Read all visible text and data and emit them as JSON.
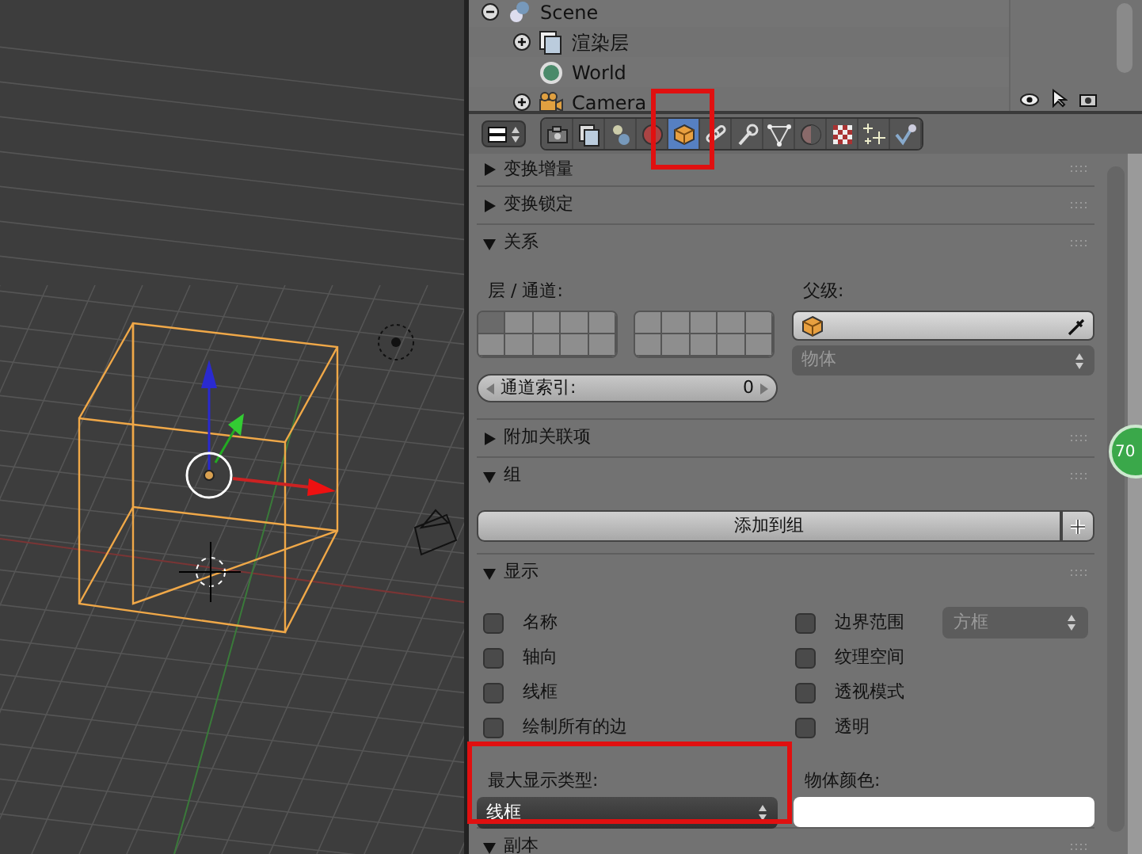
{
  "outliner": {
    "tree": [
      {
        "label": "Scene",
        "kind": "scene",
        "expanded": true,
        "children": [
          {
            "label": "渲染层",
            "kind": "render_layer",
            "expanded": false
          },
          {
            "label": "World",
            "kind": "world"
          },
          {
            "label": "Camera",
            "kind": "camera",
            "expanded": false
          }
        ]
      }
    ]
  },
  "properties_tabs": [
    {
      "kind": "render",
      "selected": false
    },
    {
      "kind": "render_layer",
      "selected": false
    },
    {
      "kind": "scene",
      "selected": false
    },
    {
      "kind": "world",
      "selected": false
    },
    {
      "kind": "object",
      "selected": true
    },
    {
      "kind": "constraint",
      "selected": false
    },
    {
      "kind": "modifier",
      "selected": false
    },
    {
      "kind": "data",
      "selected": false
    },
    {
      "kind": "material",
      "selected": false
    },
    {
      "kind": "texture",
      "selected": false
    },
    {
      "kind": "particles",
      "selected": false
    },
    {
      "kind": "physics",
      "selected": false
    }
  ],
  "panels": [
    {
      "title": "变换增量",
      "expanded": false
    },
    {
      "title": "变换锁定",
      "expanded": false
    },
    {
      "kind": "relations",
      "title": "关系",
      "expanded": true,
      "layers_label": "层 / 通道:",
      "parent_label": "父级:",
      "parent_type": "物体",
      "pass_index_label": "通道索引:",
      "pass_index": "0",
      "layers": [
        {
          "selected": true
        },
        {
          "selected": false
        },
        {
          "selected": false
        },
        {
          "selected": false
        },
        {
          "selected": false
        },
        {
          "selected": false
        },
        {
          "selected": false
        },
        {
          "selected": false
        },
        {
          "selected": false
        },
        {
          "selected": false
        },
        {
          "selected": false
        },
        {
          "selected": false
        },
        {
          "selected": false
        },
        {
          "selected": false
        },
        {
          "selected": false
        },
        {
          "selected": false
        },
        {
          "selected": false
        },
        {
          "selected": false
        },
        {
          "selected": false
        },
        {
          "selected": false
        }
      ]
    },
    {
      "title": "附加关联项",
      "expanded": false
    },
    {
      "kind": "groups",
      "title": "组",
      "expanded": true,
      "button": "添加到组"
    },
    {
      "kind": "display",
      "title": "显示",
      "expanded": true,
      "left_checks": [
        {
          "label": "名称",
          "checked": false
        },
        {
          "label": "轴向",
          "checked": false
        },
        {
          "label": "线框",
          "checked": false
        },
        {
          "label": "绘制所有的边",
          "checked": false
        }
      ],
      "right_checks": [
        {
          "label": "边界范围",
          "checked": false
        },
        {
          "label": "纹理空间",
          "checked": false
        },
        {
          "label": "透视模式",
          "checked": false
        },
        {
          "label": "透明",
          "checked": false
        }
      ],
      "bounds_type": {
        "value": "方框",
        "disabled": true
      },
      "max_draw_label": "最大显示类型:",
      "max_draw_value": "线框",
      "color_label": "物体颜色:",
      "color": "#ffffff"
    },
    {
      "kind": "plain",
      "title": "副本",
      "expanded": true
    }
  ],
  "overlay_badge": "70"
}
